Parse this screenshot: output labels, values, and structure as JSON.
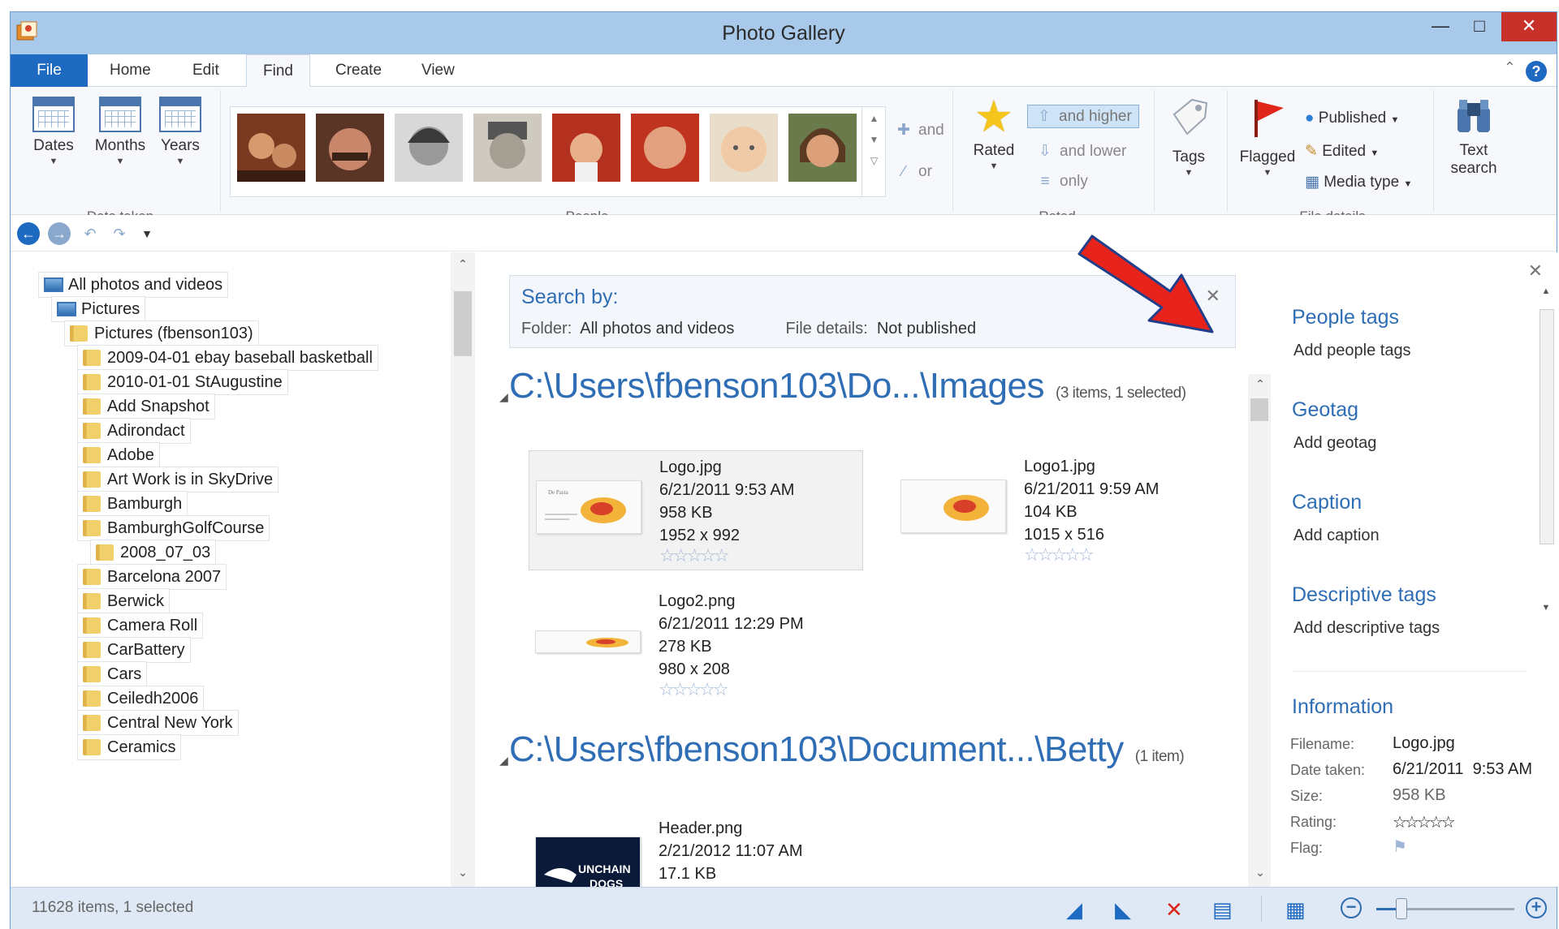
{
  "window": {
    "title": "Photo Gallery"
  },
  "tabs": [
    "File",
    "Home",
    "Edit",
    "Find",
    "Create",
    "View"
  ],
  "ribbon": {
    "date_taken": {
      "label": "Date taken",
      "buttons": [
        "Dates",
        "Months",
        "Years"
      ]
    },
    "people": {
      "label": "People",
      "and_label": "and",
      "or_label": "or"
    },
    "rated": {
      "label": "Rated",
      "button": "Rated",
      "and_higher": "and higher",
      "and_lower": "and lower",
      "only": "only"
    },
    "tags": {
      "button": "Tags"
    },
    "file_details": {
      "label": "File details",
      "flagged": "Flagged",
      "published": "Published",
      "edited": "Edited",
      "media_type": "Media type"
    },
    "text_search": {
      "line1": "Text",
      "line2": "search"
    }
  },
  "tree": {
    "items": [
      {
        "label": "All photos and videos",
        "type": "all"
      },
      {
        "label": "Pictures",
        "type": "pictures"
      },
      {
        "label": "Pictures (fbenson103)",
        "type": "folder"
      },
      {
        "label": "2009-04-01 ebay baseball basketball",
        "type": "folder"
      },
      {
        "label": "2010-01-01 StAugustine",
        "type": "folder"
      },
      {
        "label": "Add Snapshot",
        "type": "folder"
      },
      {
        "label": "Adirondact",
        "type": "folder"
      },
      {
        "label": "Adobe",
        "type": "folder"
      },
      {
        "label": "Art Work is in SkyDrive",
        "type": "folder"
      },
      {
        "label": "Bamburgh",
        "type": "folder"
      },
      {
        "label": "BamburghGolfCourse",
        "type": "folder"
      },
      {
        "label": "2008_07_03",
        "type": "folder"
      },
      {
        "label": "Barcelona 2007",
        "type": "folder"
      },
      {
        "label": "Berwick",
        "type": "folder"
      },
      {
        "label": "Camera Roll",
        "type": "folder"
      },
      {
        "label": "CarBattery",
        "type": "folder"
      },
      {
        "label": "Cars",
        "type": "folder"
      },
      {
        "label": "Ceiledh2006",
        "type": "folder"
      },
      {
        "label": "Central New York",
        "type": "folder"
      },
      {
        "label": "Ceramics",
        "type": "folder"
      }
    ]
  },
  "search": {
    "title": "Search by:",
    "folder_key": "Folder:",
    "folder_value": "All photos and videos",
    "details_key": "File details:",
    "details_value": "Not published"
  },
  "groups": [
    {
      "path": "C:\\Users\\fbenson103\\Do...\\Images",
      "count": "(3 items, 1 selected)",
      "files": [
        {
          "name": "Logo.jpg",
          "date": "6/21/2011 9:53 AM",
          "size": "958 KB",
          "dims": "1952 x 992",
          "rating": 0,
          "selected": true
        },
        {
          "name": "Logo1.jpg",
          "date": "6/21/2011 9:59 AM",
          "size": "104 KB",
          "dims": "1015 x 516",
          "rating": 0,
          "selected": false
        },
        {
          "name": "Logo2.png",
          "date": "6/21/2011 12:29 PM",
          "size": "278 KB",
          "dims": "980 x 208",
          "rating": 0,
          "selected": false
        }
      ]
    },
    {
      "path": "C:\\Users\\fbenson103\\Document...\\Betty",
      "count": "(1 item)",
      "files": [
        {
          "name": "Header.png",
          "date": "2/21/2012 11:07 AM",
          "size": "17.1 KB",
          "thumb_text": "UNCHAIN DOGS"
        }
      ]
    }
  ],
  "stars_glyph": "☆☆☆☆☆",
  "right_pane": {
    "people_tags": "People tags",
    "add_people_tags": "Add people tags",
    "geotag": "Geotag",
    "add_geotag": "Add geotag",
    "caption": "Caption",
    "add_caption": "Add caption",
    "descriptive_tags": "Descriptive tags",
    "add_descriptive_tags": "Add descriptive tags",
    "information": "Information",
    "info": {
      "filename_key": "Filename:",
      "filename": "Logo.jpg",
      "date_key": "Date taken:",
      "date": "6/21/2011  9:53 AM",
      "size_key": "Size:",
      "size": "958 KB",
      "rating_key": "Rating:",
      "rating": 0,
      "flag_key": "Flag:"
    }
  },
  "status": {
    "text": "11628 items, 1 selected",
    "zoom_level": 0.18
  },
  "colors": {
    "accent": "#2f6db5",
    "title_bar": "#a9c9ea",
    "close_button": "#c7312a",
    "annotation_arrow": "#e8231c"
  }
}
